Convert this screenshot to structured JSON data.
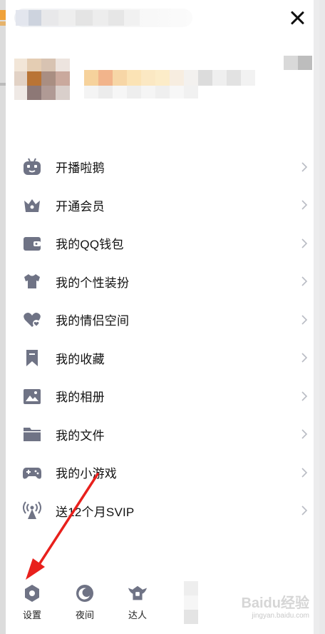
{
  "header": {
    "close_icon": "close-icon"
  },
  "menu": {
    "items": [
      {
        "label": "开播啦鹅",
        "icon": "live-tv-icon"
      },
      {
        "label": "开通会员",
        "icon": "crown-icon"
      },
      {
        "label": "我的QQ钱包",
        "icon": "wallet-icon"
      },
      {
        "label": "我的个性装扮",
        "icon": "shirt-icon"
      },
      {
        "label": "我的情侣空间",
        "icon": "heart-icon"
      },
      {
        "label": "我的收藏",
        "icon": "bookmark-icon"
      },
      {
        "label": "我的相册",
        "icon": "photo-album-icon"
      },
      {
        "label": "我的文件",
        "icon": "folder-icon"
      },
      {
        "label": "我的小游戏",
        "icon": "gamepad-icon"
      },
      {
        "label": "送12个月SVIP",
        "icon": "signal-tower-icon"
      }
    ]
  },
  "bottom_bar": {
    "settings_label": "设置",
    "night_label": "夜间",
    "expert_label": "达人"
  },
  "watermark": {
    "brand": "Baidu经验",
    "url": "jingyan.baidu.com"
  },
  "colors": {
    "icon_gray": "#6f7385",
    "chevron": "#b9bcc4",
    "arrow_red": "#e8201c"
  }
}
